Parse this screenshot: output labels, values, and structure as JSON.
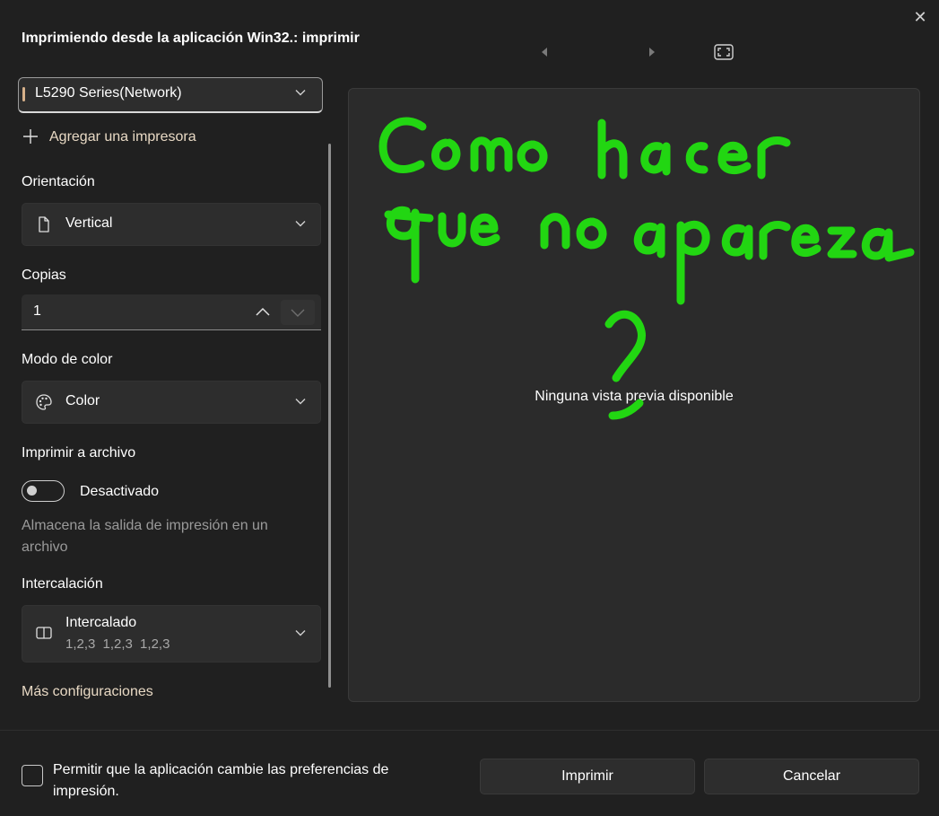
{
  "dialog": {
    "title": "Imprimiendo desde la aplicación Win32.: imprimir",
    "close_icon": "close-icon"
  },
  "toolbar": {
    "prev_icon": "triangle-left-icon",
    "next_icon": "triangle-right-icon",
    "fit_icon": "fit-to-page-icon"
  },
  "printer": {
    "selected": "L5290 Series(Network)",
    "add_label": "Agregar una impresora"
  },
  "orientation": {
    "label": "Orientación",
    "value": "Vertical"
  },
  "copies": {
    "label": "Copias",
    "value": "1"
  },
  "color_mode": {
    "label": "Modo de color",
    "value": "Color"
  },
  "print_to_file": {
    "label": "Imprimir a archivo",
    "toggle_label": "Desactivado",
    "toggle_on": false,
    "description": "Almacena la salida de impresión en un archivo"
  },
  "collation": {
    "label": "Intercalación",
    "value": "Intercalado",
    "sub": "1,2,3  1,2,3  1,2,3"
  },
  "more_settings": "Más configuraciones",
  "preview": {
    "message": "Ninguna vista previa disponible",
    "handwritten_note": "Como hacer que no aparezca ?",
    "note_color": "#22d612"
  },
  "footer": {
    "checkbox_label": "Permitir que la aplicación cambie las preferencias de impresión.",
    "checked": false,
    "print_button": "Imprimir",
    "cancel_button": "Cancelar"
  },
  "colors": {
    "background": "#202020",
    "surface": "#2d2d2d",
    "link": "#e8d9c4",
    "muted": "#9a9a9a"
  }
}
